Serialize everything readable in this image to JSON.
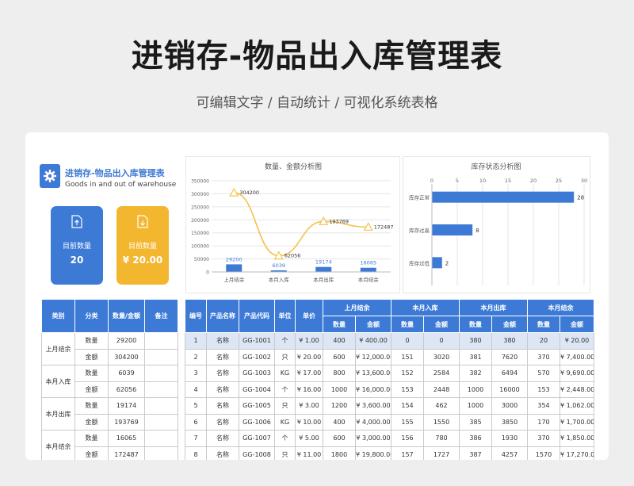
{
  "header": {
    "title": "进销存-物品出入库管理表",
    "subtitle": "可编辑文字 / 自动统计 / 可视化系统表格"
  },
  "app": {
    "title": "进销存-物品出入库管理表",
    "subtitle": "Goods in and out of warehouse",
    "icon": "gear-icon"
  },
  "cards": [
    {
      "label": "目前数量",
      "value": "20",
      "color": "#3d7ad6",
      "icon": "upload-file-icon"
    },
    {
      "label": "目前数量",
      "value": "¥ 20.00",
      "color": "#f3b62f",
      "icon": "download-file-icon"
    }
  ],
  "left_table": {
    "headers": [
      "类别",
      "分类",
      "数量/金额",
      "备注"
    ],
    "groups": [
      {
        "category": "上月结余",
        "rows": [
          {
            "type": "数量",
            "value": "29200"
          },
          {
            "type": "金额",
            "value": "304200"
          }
        ]
      },
      {
        "category": "本月入库",
        "rows": [
          {
            "type": "数量",
            "value": "6039"
          },
          {
            "type": "金额",
            "value": "62056"
          }
        ]
      },
      {
        "category": "本月出库",
        "rows": [
          {
            "type": "数量",
            "value": "19174"
          },
          {
            "type": "金额",
            "value": "193769"
          }
        ]
      },
      {
        "category": "本月结余",
        "rows": [
          {
            "type": "数量",
            "value": "16065"
          },
          {
            "type": "金额",
            "value": "172487"
          }
        ]
      }
    ]
  },
  "main_table": {
    "headers_top": [
      "编号",
      "产品名称",
      "产品代码",
      "单位",
      "单价",
      "上月结余",
      "本月入库",
      "本月出库",
      "本月结余"
    ],
    "headers_sub": [
      "数量",
      "金额",
      "数量",
      "金额",
      "数量",
      "金额",
      "数量",
      "金额"
    ],
    "rows": [
      [
        "1",
        "名称",
        "GG-1001",
        "个",
        "¥ 1.00",
        "400",
        "¥ 400.00",
        "0",
        "0",
        "380",
        "380",
        "20",
        "¥ 20.00"
      ],
      [
        "2",
        "名称",
        "GG-1002",
        "只",
        "¥ 20.00",
        "600",
        "¥ 12,000.00",
        "151",
        "3020",
        "381",
        "7620",
        "370",
        "¥ 7,400.00"
      ],
      [
        "3",
        "名称",
        "GG-1003",
        "KG",
        "¥ 17.00",
        "800",
        "¥ 13,600.00",
        "152",
        "2584",
        "382",
        "6494",
        "570",
        "¥ 9,690.00"
      ],
      [
        "4",
        "名称",
        "GG-1004",
        "个",
        "¥ 16.00",
        "1000",
        "¥ 16,000.00",
        "153",
        "2448",
        "1000",
        "16000",
        "153",
        "¥ 2,448.00"
      ],
      [
        "5",
        "名称",
        "GG-1005",
        "只",
        "¥ 3.00",
        "1200",
        "¥ 3,600.00",
        "154",
        "462",
        "1000",
        "3000",
        "354",
        "¥ 1,062.00"
      ],
      [
        "6",
        "名称",
        "GG-1006",
        "KG",
        "¥ 10.00",
        "400",
        "¥ 4,000.00",
        "155",
        "1550",
        "385",
        "3850",
        "170",
        "¥ 1,700.00"
      ],
      [
        "7",
        "名称",
        "GG-1007",
        "个",
        "¥ 5.00",
        "600",
        "¥ 3,000.00",
        "156",
        "780",
        "386",
        "1930",
        "370",
        "¥ 1,850.00"
      ],
      [
        "8",
        "名称",
        "GG-1008",
        "只",
        "¥ 11.00",
        "1800",
        "¥ 19,800.00",
        "157",
        "1727",
        "387",
        "4257",
        "1570",
        "¥ 17,270.00"
      ]
    ]
  },
  "chart_data": [
    {
      "type": "bar+line",
      "title": "数量、金额分析图",
      "categories": [
        "上月结余",
        "本月入库",
        "本月出库",
        "本月结余"
      ],
      "series": [
        {
          "kind": "bar",
          "values": [
            29200,
            6039,
            19174,
            16065
          ],
          "color": "#3d7ad6"
        },
        {
          "kind": "line",
          "values": [
            304200,
            62056,
            193769,
            172487
          ],
          "color": "#f3c24c"
        }
      ],
      "y_ticks": [
        "0",
        "50000",
        "100000",
        "150000",
        "200000",
        "250000",
        "300000",
        "350000"
      ],
      "ylim": [
        0,
        350000
      ],
      "grid": true
    },
    {
      "type": "bar",
      "orientation": "horizontal",
      "title": "库存状态分析图",
      "categories": [
        "库存正常",
        "库存过高",
        "库存过低"
      ],
      "values": [
        28,
        8,
        2
      ],
      "x_ticks": [
        "0",
        "5",
        "10",
        "15",
        "20",
        "25",
        "30"
      ],
      "xlim": [
        0,
        30
      ],
      "color": "#3d7ad6",
      "grid": true
    }
  ]
}
